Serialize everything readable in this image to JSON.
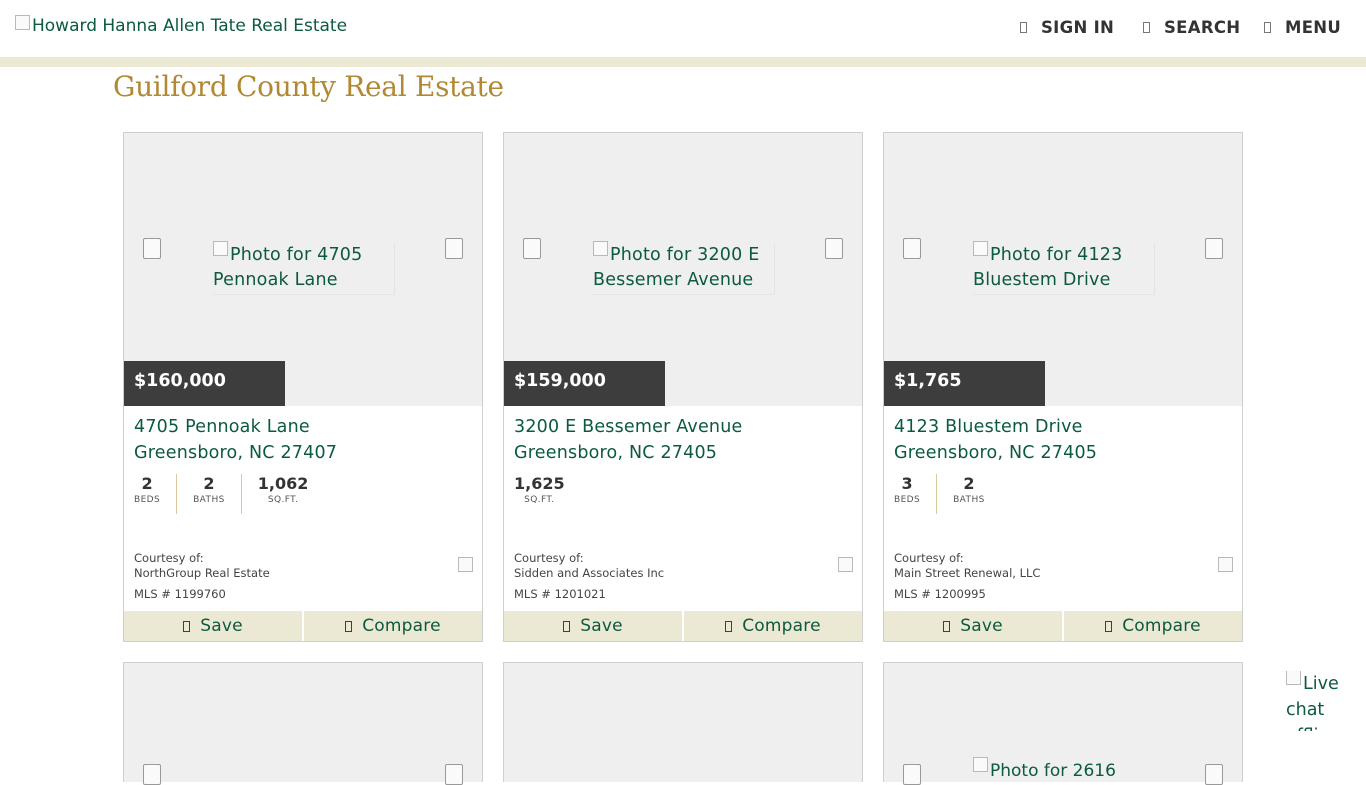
{
  "header": {
    "logo_alt": "Howard Hanna Allen Tate Real Estate",
    "nav": [
      {
        "label": "SIGN IN"
      },
      {
        "label": "SEARCH"
      },
      {
        "label": "MENU"
      }
    ]
  },
  "page": {
    "title": "Guilford County Real Estate"
  },
  "listings": [
    {
      "photo_alt_line1": "Photo for 4705",
      "photo_alt_line2": "Pennoak Lane",
      "price": "$160,000",
      "street": "4705 Pennoak Lane",
      "city": "Greensboro, NC 27407",
      "stats": [
        {
          "value": "2",
          "label": "BEDS"
        },
        {
          "value": "2",
          "label": "BATHS"
        },
        {
          "value": "1,062",
          "label": "SQ.FT."
        }
      ],
      "courtesy_label": "Courtesy of:",
      "broker": "NorthGroup Real Estate",
      "mls": "MLS # 1199760",
      "save_label": "Save",
      "compare_label": "Compare"
    },
    {
      "photo_alt_line1": "Photo for 3200 E",
      "photo_alt_line2": "Bessemer Avenue",
      "price": "$159,000",
      "street": "3200 E Bessemer Avenue",
      "city": "Greensboro, NC 27405",
      "stats": [
        {
          "value": "1,625",
          "label": "SQ.FT."
        }
      ],
      "courtesy_label": "Courtesy of:",
      "broker": "Sidden and Associates Inc",
      "mls": "MLS # 1201021",
      "save_label": "Save",
      "compare_label": "Compare"
    },
    {
      "photo_alt_line1": "Photo for 4123",
      "photo_alt_line2": "Bluestem Drive",
      "price": "$1,765",
      "street": "4123 Bluestem Drive",
      "city": "Greensboro, NC 27405",
      "stats": [
        {
          "value": "3",
          "label": "BEDS"
        },
        {
          "value": "2",
          "label": "BATHS"
        }
      ],
      "courtesy_label": "Courtesy of:",
      "broker": "Main Street Renewal, LLC",
      "mls": "MLS # 1200995",
      "save_label": "Save",
      "compare_label": "Compare"
    }
  ],
  "peek_cards": [
    {
      "photo_alt": ""
    },
    {
      "photo_alt": ""
    },
    {
      "photo_alt": "Photo for 2616"
    }
  ],
  "livechat": {
    "alt": "Live chat offline"
  },
  "colors": {
    "brand_green": "#0b5a40",
    "title_gold": "#b18935",
    "stripe_beige": "#ebe8d4",
    "price_bg": "#3d3d3d"
  }
}
